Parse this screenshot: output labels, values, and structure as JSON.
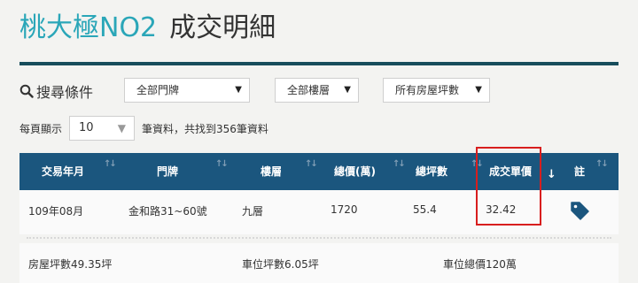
{
  "title": {
    "name": "桃大極NO2",
    "suffix": "成交明細"
  },
  "search": {
    "label": "搜尋條件",
    "door_select": "全部門牌",
    "floor_select": "全部樓層",
    "area_select": "所有房屋坪數"
  },
  "paging": {
    "per_page_label": "每頁顯示",
    "per_page_value": "10",
    "result_text": "筆資料，共找到356筆資料"
  },
  "table": {
    "headers": [
      "交易年月",
      "門牌",
      "樓層",
      "總價(萬)",
      "總坪數",
      "成交單價",
      "註"
    ],
    "row": {
      "date": "109年08月",
      "address": "金和路31~60號",
      "floor": "九層",
      "total_price": "1720",
      "total_area": "55.4",
      "unit_price": "32.42"
    },
    "details": {
      "house_area": "房屋坪數49.35坪",
      "parking_area": "車位坪數6.05坪",
      "parking_price": "車位總價120萬"
    }
  },
  "colors": {
    "accent": "#2aa6b8",
    "header_bg": "#1b567e",
    "rule": "#174d5c",
    "highlight": "#d81e1e",
    "tag_icon": "#1b567e"
  },
  "icons": {
    "search": "magnifier-icon",
    "sort": "sort-arrows-icon",
    "sort_active": "sort-down-icon",
    "note": "price-tag-icon"
  }
}
